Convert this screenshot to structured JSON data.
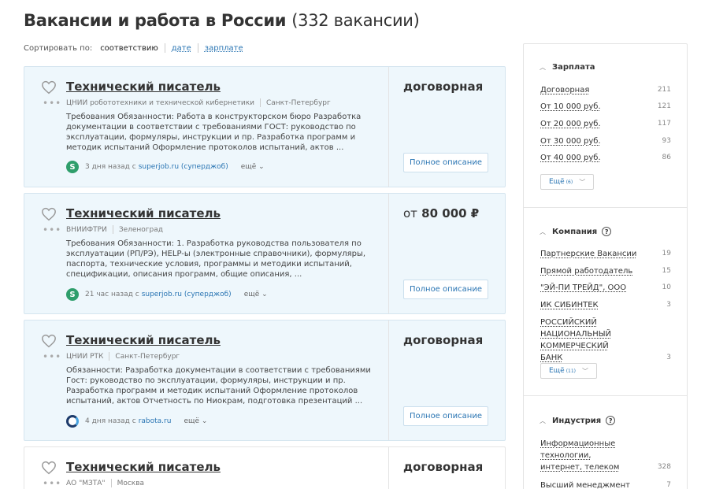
{
  "header": {
    "title": "Вакансии и работа в России",
    "count": "(332 вакансии)"
  },
  "sort": {
    "label": "Сортировать по:",
    "active": "соответствию",
    "options": [
      "дате",
      "зарплате"
    ]
  },
  "vacancies": [
    {
      "title": "Технический писатель",
      "company": "ЦНИИ робототехники и технической кибернетики",
      "city": "Санкт-Петербург",
      "description": "Требования Обязанности: Работа в конструкторском бюро Разработка документации в соответствии с требованиями ГОСТ: руководство по эксплуатации, формуляры, инструкции и пр. Разработка программ и методик испытаний Оформление протоколов испытаний, актов ...",
      "time": "3 дня назад с",
      "source": "superjob.ru (суперджоб)",
      "source_icon": "S",
      "more": "ещё",
      "salary_prefix": "",
      "salary": "договорная",
      "button": "Полное описание"
    },
    {
      "title": "Технический писатель",
      "company": "ВНИИФТРИ",
      "city": "Зеленоград",
      "description": "Требования Обязанности: 1. Разработка руководства пользователя по эксплуатации (РП/РЭ), HELP-ы (электронные справочники), формуляры, паспорта, технические условия, программы и методики испытаний, спецификации, описания программ, общие описания, ...",
      "time": "21 час назад с",
      "source": "superjob.ru (суперджоб)",
      "source_icon": "S",
      "more": "ещё",
      "salary_prefix": "от",
      "salary": "80 000 ₽",
      "button": "Полное описание"
    },
    {
      "title": "Технический писатель",
      "company": "ЦНИИ РТК",
      "city": "Санкт-Петербург",
      "description": "Обязанности: Разработка документации в соответствии с требованиями Гост: руководство по эксплуатации, формуляры, инструкции и пр. Разработка программ и методик испытаний Оформление протоколов испытаний, актов Отчетность по Ниокрам, подготовка презентаций ...",
      "time": "4 дня назад с",
      "source": "rabota.ru",
      "source_icon": "",
      "more": "ещё",
      "salary_prefix": "",
      "salary": "договорная",
      "button": "Полное описание"
    },
    {
      "title": "Технический писатель",
      "company": "АО \"МЗТА\"",
      "city": "Москва",
      "salary_prefix": "",
      "salary": "договорная"
    }
  ],
  "filters": {
    "salary": {
      "title": "Зарплата",
      "items": [
        {
          "label": "Договорная",
          "count": "211"
        },
        {
          "label": "От 10 000 руб.",
          "count": "121"
        },
        {
          "label": "От 20 000 руб.",
          "count": "117"
        },
        {
          "label": "От 30 000 руб.",
          "count": "93"
        },
        {
          "label": "От 40 000 руб.",
          "count": "86"
        }
      ],
      "more_label": "Ещё",
      "more_count": "(6)"
    },
    "company": {
      "title": "Компания",
      "items": [
        {
          "label": "Партнерские Вакансии",
          "count": "19"
        },
        {
          "label": "Прямой работодатель",
          "count": "15"
        },
        {
          "label": "\"ЭЙ-ПИ ТРЕЙД\", ООО",
          "count": "10"
        },
        {
          "label": "ИК СИБИНТЕК",
          "count": "3"
        },
        {
          "label": "РОССИЙСКИЙ НАЦИОНАЛЬНЫЙ КОММЕРЧЕСКИЙ БАНК",
          "count": "3"
        }
      ],
      "more_label": "Ещё",
      "more_count": "(11)"
    },
    "industry": {
      "title": "Индустрия",
      "items": [
        {
          "label": "Информационные технологии, интернет, телеком",
          "count": "328"
        },
        {
          "label": "Высший менеджмент",
          "count": "7"
        }
      ]
    }
  }
}
